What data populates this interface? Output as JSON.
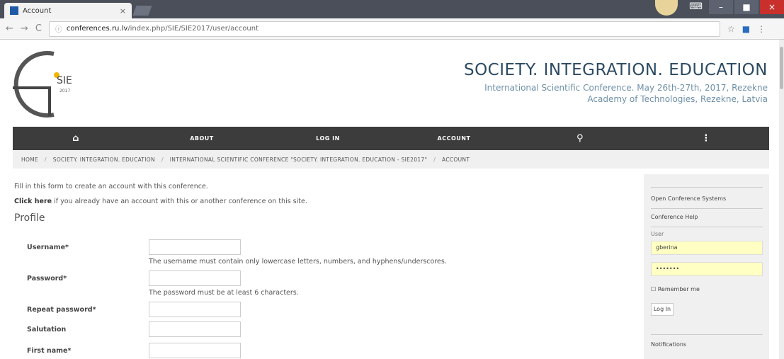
{
  "browser": {
    "tab_title": "Account",
    "tab_close": "×",
    "url_host": "conferences.ru.lv",
    "url_path": "/index.php/SIE/SIE2017/user/account",
    "nav_back": "←",
    "nav_forward": "→",
    "nav_reload": "C",
    "star": "☆",
    "win_min": "–",
    "win_max": "■",
    "win_close": "×"
  },
  "header": {
    "logo_text": "SIE",
    "logo_year": "2017",
    "title": "SOCIETY. INTEGRATION. EDUCATION",
    "subtitle_line1": "International Scientific Conference. May 26th-27th, 2017, Rezekne",
    "subtitle_line2": "Academy of Technologies, Rezekne, Latvia"
  },
  "nav": {
    "home_icon": "home-icon",
    "about": "ABOUT",
    "login": "LOG IN",
    "account": "ACCOUNT",
    "search_icon": "search-icon",
    "more_icon": "more-icon"
  },
  "breadcrumb": {
    "home": "HOME",
    "b1": "SOCIETY. INTEGRATION. EDUCATION",
    "b2": "INTERNATIONAL SCIENTIFIC CONFERENCE \"SOCIETY. INTEGRATION. EDUCATION - SIE2017\"",
    "b3": "ACCOUNT"
  },
  "content": {
    "intro": "Fill in this form to create an account with this conference.",
    "click_here": "Click here",
    "intro2_rest": " if you already have an account with this or another conference on this site.",
    "profile_heading": "Profile",
    "fields": {
      "username": "Username*",
      "username_hint": "The username must contain only lowercase letters, numbers, and hyphens/underscores.",
      "password": "Password*",
      "password_hint": "The password must be at least 6 characters.",
      "repeat": "Repeat password*",
      "salutation": "Salutation",
      "first_name": "First name*"
    }
  },
  "sidebar": {
    "ocs": "Open Conference Systems",
    "help": "Conference Help",
    "user_label": "User",
    "username_value": "gberina",
    "password_value": "•••••••",
    "remember": "Remember me",
    "login_btn": "Log In",
    "notifications": "Notifications"
  }
}
